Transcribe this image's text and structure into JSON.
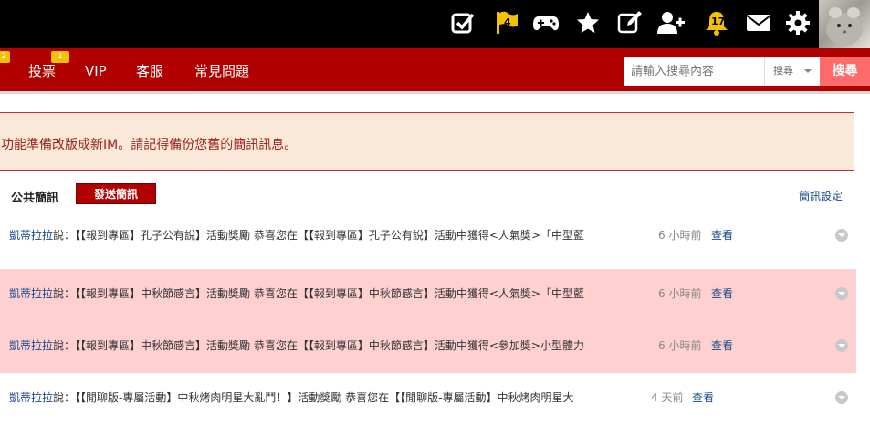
{
  "topbar": {
    "badges": {
      "flag": "4",
      "bell": "17"
    },
    "icons": [
      "check-square-icon",
      "flag-icon",
      "gamepad-icon",
      "star-icon",
      "edit-icon",
      "add-user-icon",
      "bell-icon",
      "mail-icon",
      "gear-icon"
    ],
    "colors": {
      "background": "#000000",
      "icon": "#ffffff",
      "flag": "#f2c200",
      "bell": "#f2c200"
    }
  },
  "nav": {
    "badges": [
      "2",
      "1"
    ],
    "items": [
      "投票",
      "VIP",
      "客服",
      "常見問題"
    ],
    "search": {
      "placeholder": "請輸入搜尋內容",
      "select": "搜尋",
      "button": "搜尋"
    },
    "colors": {
      "background": "#b00000",
      "search_button": "#ff6a6a"
    }
  },
  "notice": {
    "text": "功能準備改版成新IM。請記得備份您舊的簡訊訊息。"
  },
  "messages": {
    "title": "公共簡訊",
    "send_button": "發送簡訊",
    "settings_link": "簡訊設定",
    "rows": [
      {
        "user": "凱蒂拉拉",
        "said": "說：",
        "text": "【【報到專區】孔子公有說】活動獎勵 恭喜您在【【報到專區】孔子公有說】活動中獲得<人氣獎>「中型藍",
        "time": "6 小時前",
        "view": "查看",
        "highlighted": false
      },
      {
        "user": "凱蒂拉拉",
        "said": "說：",
        "text": "【【報到專區】中秋節感言】活動獎勵 恭喜您在【【報到專區】中秋節感言】活動中獲得<人氣獎>「中型藍",
        "time": "6 小時前",
        "view": "查看",
        "highlighted": true
      },
      {
        "user": "凱蒂拉拉",
        "said": "說：",
        "text": "【【報到專區】中秋節感言】活動獎勵 恭喜您在【【報到專區】中秋節感言】活動中獲得<參加獎>小型體力",
        "time": "6 小時前",
        "view": "查看",
        "highlighted": true
      },
      {
        "user": "凱蒂拉拉",
        "said": "說：",
        "text": "【【閒聊版-專屬活動】中秋烤肉明星大亂鬥！】活動獎勵 恭喜您在【【閒聊版-專屬活動】中秋烤肉明星大",
        "time": "4 天前",
        "view": "查看",
        "highlighted": false
      }
    ],
    "colors": {
      "highlight": "#ffd0d0",
      "link": "#1a4a8a"
    }
  }
}
